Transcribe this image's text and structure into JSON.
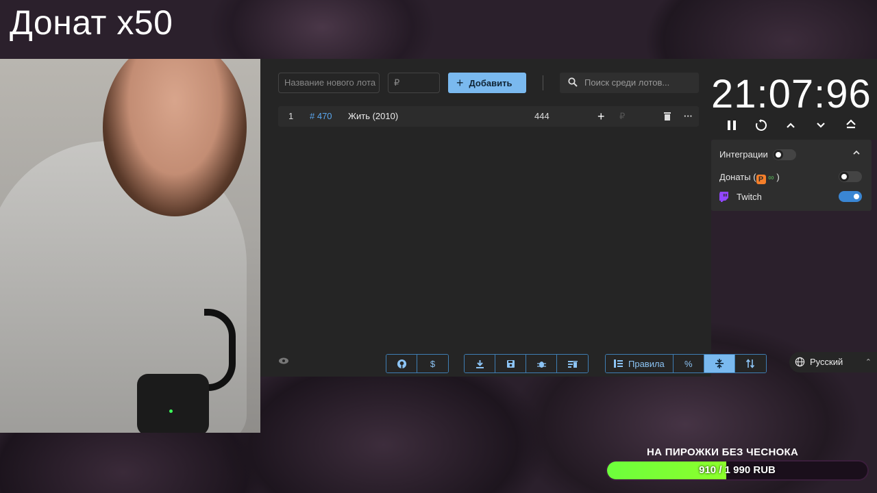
{
  "overlay": {
    "title": "Донат x50"
  },
  "auction": {
    "new_lot_placeholder": "Название нового лота",
    "amount_placeholder": "₽",
    "add_button": "Добавить",
    "search_placeholder": "Поиск среди лотов...",
    "lots": [
      {
        "index": "1",
        "id": "# 470",
        "name": "Жить (2010)",
        "amount": "444",
        "add": "+",
        "currency": "₽"
      }
    ],
    "footer": {
      "group1": [
        "github-icon",
        "$"
      ],
      "group2": [
        "download-icon",
        "save-icon",
        "bug-icon",
        "clear-icon"
      ],
      "group3": {
        "rules_label": "Правила",
        "percent": "%",
        "active": "divide-icon",
        "sort": "sort-icon"
      },
      "language": "Русский"
    }
  },
  "timer": {
    "time": "21:07:96"
  },
  "integrations": {
    "title": "Интеграции",
    "items": [
      {
        "label_prefix": "Донаты (",
        "label_suffix": " )",
        "enabled": false
      },
      {
        "label": "Twitch",
        "enabled": true
      }
    ]
  },
  "goal": {
    "title": "НА ПИРОЖКИ БЕЗ ЧЕСНОКА",
    "current": "910",
    "total": "1 990",
    "currency": "RUB",
    "text": "910 / 1 990 RUB",
    "progress": 0.457,
    "fill_color": "#7cff36"
  }
}
